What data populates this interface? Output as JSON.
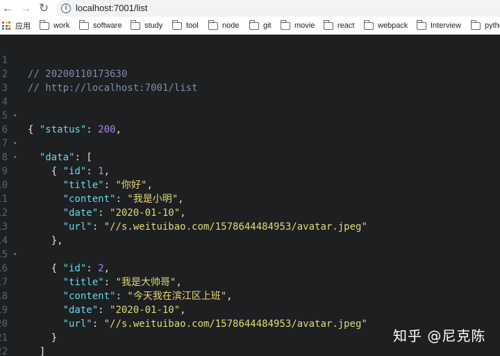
{
  "browser": {
    "nav": {
      "back": "←",
      "forward": "→",
      "reload": "↻"
    },
    "info_icon": "i",
    "url": "localhost:7001/list",
    "apps_label": "应用",
    "apps_colors": [
      "#ea4335",
      "#fbbc05",
      "#34a853",
      "#4285f4",
      "#ea4335",
      "#fbbc05",
      "#34a853",
      "#4285f4",
      "#ea4335"
    ],
    "bookmarks": [
      "work",
      "software",
      "study",
      "tool",
      "node",
      "git",
      "movie",
      "react",
      "webpack",
      "Interview",
      "pytho"
    ]
  },
  "editor": {
    "line_numbers": [
      "1",
      "2",
      "3",
      "4",
      "5",
      "6",
      "7",
      "8",
      "9",
      "10",
      "11",
      "12",
      "13",
      "14",
      "15",
      "16",
      "17",
      "18",
      "19",
      "20",
      "21",
      "22"
    ],
    "fold_marker": "▾",
    "comment_1": "// 20200110173630",
    "comment_2": "// http://localhost:7001/list",
    "open_brace": "{",
    "close_brace": "}",
    "status_key": "\"status\"",
    "status_value": "200",
    "data_key": "\"data\"",
    "open_bracket": "[",
    "close_bracket": "]",
    "keys": {
      "id": "\"id\"",
      "title": "\"title\"",
      "content": "\"content\"",
      "date": "\"date\"",
      "url": "\"url\""
    },
    "items": [
      {
        "id": "1",
        "title": "\"你好\"",
        "content": "\"我是小明\"",
        "date": "\"2020-01-10\"",
        "url": "\"//s.weituibao.com/1578644484953/avatar.jpeg\""
      },
      {
        "id": "2",
        "title": "\"我是大帅哥\"",
        "content": "\"今天我在滨江区上班\"",
        "date": "\"2020-01-10\"",
        "url": "\"//s.weituibao.com/1578644484953/avatar.jpeg\""
      }
    ]
  },
  "watermark": "知乎 @尼克陈"
}
